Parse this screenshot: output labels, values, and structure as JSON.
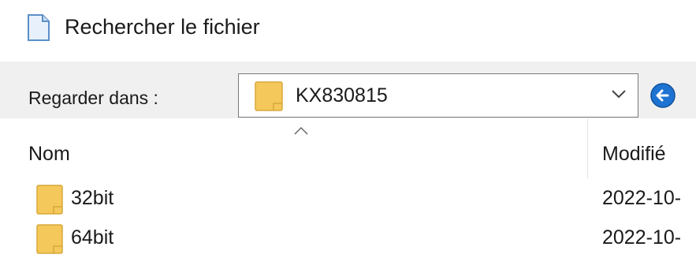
{
  "window": {
    "title": "Rechercher le fichier",
    "title_icon": "document-icon"
  },
  "look_in": {
    "label": "Regarder dans :",
    "selected": "KX830815",
    "icon": "folder-icon"
  },
  "toolbar": {
    "back_icon": "back-arrow-icon",
    "accent": "#1e73d2"
  },
  "list": {
    "sort_indicator": "^",
    "columns": [
      {
        "label": "Nom"
      },
      {
        "label": "Modifié"
      }
    ],
    "rows": [
      {
        "name": "32bit",
        "modified": "2022-10-",
        "icon": "folder-icon"
      },
      {
        "name": "64bit",
        "modified": "2022-10-",
        "icon": "folder-icon"
      }
    ]
  },
  "colors": {
    "folder": "#f4c85a",
    "folder_dark": "#d9a73a",
    "panel": "#f0f0f0"
  }
}
